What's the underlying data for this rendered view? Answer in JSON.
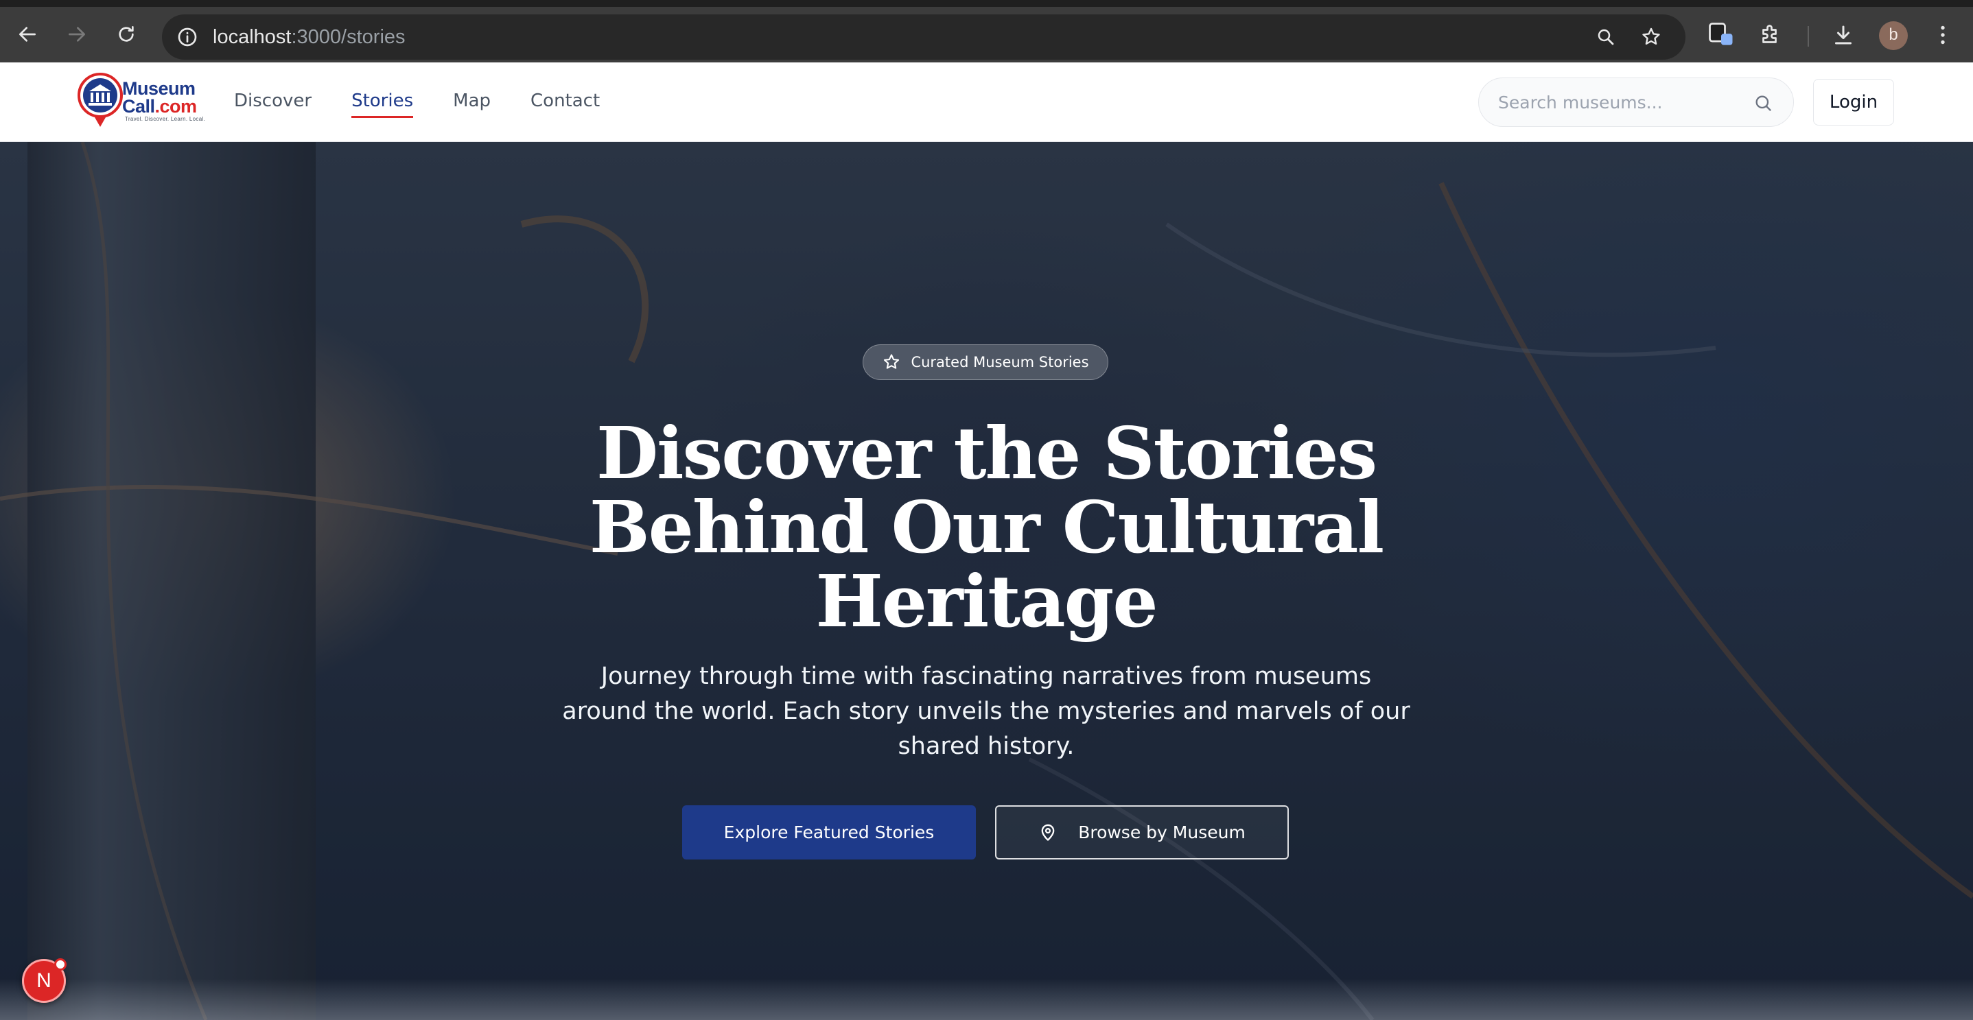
{
  "browser": {
    "url_host": "localhost",
    "url_path": ":3000/stories",
    "avatar_letter": "b"
  },
  "header": {
    "logo": {
      "brand_line1": "Museum",
      "brand_line2": "Call",
      "brand_tld": ".com",
      "tagline": "Travel. Discover. Learn. Local."
    },
    "nav": [
      {
        "label": "Discover",
        "active": false
      },
      {
        "label": "Stories",
        "active": true
      },
      {
        "label": "Map",
        "active": false
      },
      {
        "label": "Contact",
        "active": false
      }
    ],
    "search": {
      "placeholder": "Search museums...",
      "value": ""
    },
    "login_label": "Login"
  },
  "hero": {
    "badge": "Curated Museum Stories",
    "title_lines": [
      "Discover the Stories",
      "Behind Our Cultural",
      "Heritage"
    ],
    "lead": "Journey through time with fascinating narratives from museums around the world. Each story unveils the mysteries and marvels of our shared history.",
    "primary_cta": "Explore Featured Stories",
    "secondary_cta": "Browse by Museum"
  },
  "floating": {
    "notification_letter": "N"
  },
  "colors": {
    "brand_navy": "#1e3a8a",
    "brand_red": "#dc2626",
    "chrome_dark": "#3c3c3c"
  }
}
